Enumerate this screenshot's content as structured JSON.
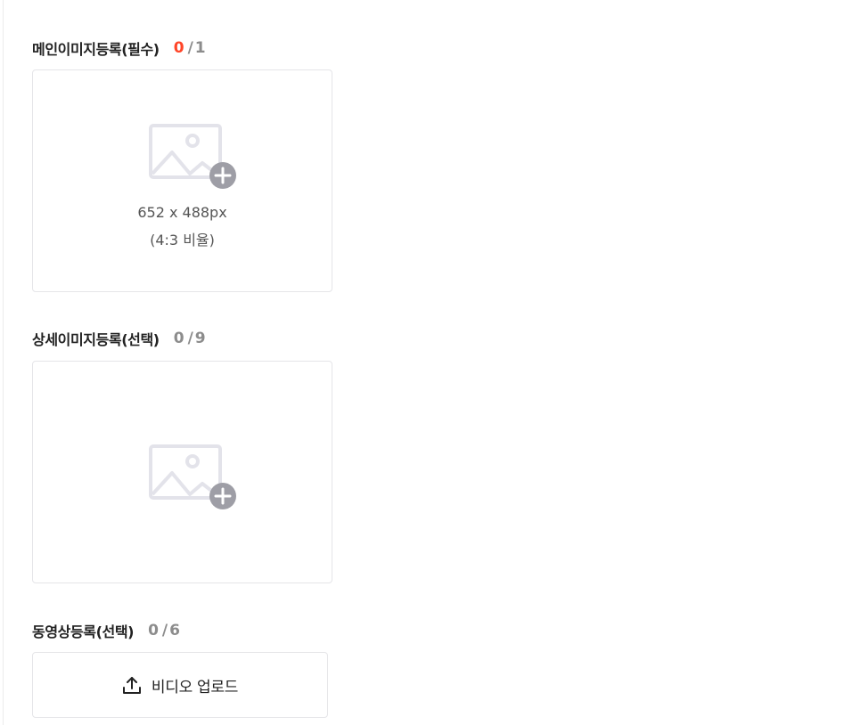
{
  "main_image": {
    "title": "메인이미지등록(필수)",
    "current": "0",
    "max": "1",
    "size_hint": "652 x 488px",
    "ratio_hint": "(4:3 비율)",
    "icon": "image-add-icon"
  },
  "detail_image": {
    "title": "상세이미지등록(선택)",
    "current": "0",
    "max": "9",
    "icon": "image-add-icon"
  },
  "video": {
    "title": "동영상등록(선택)",
    "current": "0",
    "max": "6",
    "button_label": "비디오 업로드",
    "icon": "upload-icon"
  },
  "colors": {
    "required_count": "#ff4528",
    "muted_count": "#8c8c8c",
    "icon_light": "#e3e3ea",
    "icon_plus": "#9e9ea6"
  },
  "separator": "/"
}
